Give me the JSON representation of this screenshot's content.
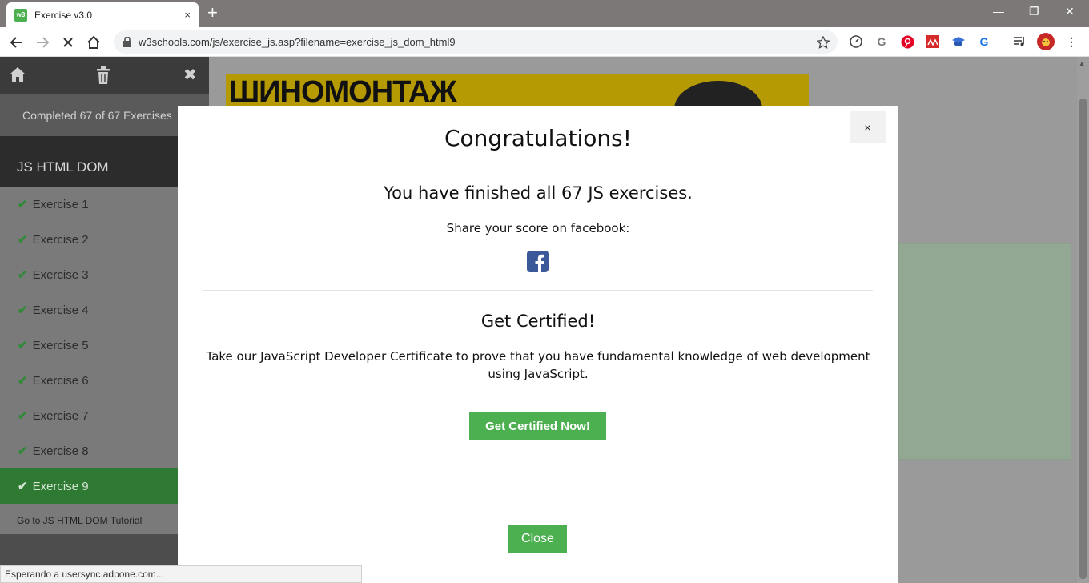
{
  "browser": {
    "tab_title": "Exercise v3.0",
    "favicon_text": "w3",
    "tab_close": "×",
    "new_tab": "+",
    "url": "w3schools.com/js/exercise_js.asp?filename=exercise_js_dom_html9",
    "window_controls": {
      "minimize": "—",
      "restore": "❐",
      "close": "✕"
    },
    "extensions": [
      "speed-icon",
      "google-icon",
      "pinterest-icon",
      "mosaic-icon",
      "cap-icon",
      "grammarly-icon",
      "media-icon",
      "avatar-icon"
    ],
    "extension_glyphs": {
      "google": "G",
      "grammarly": "G",
      "more": "⋮"
    },
    "status": "Esperando a usersync.adpone.com..."
  },
  "sidebar": {
    "completed": "Completed 67 of 67 Exercises",
    "section_title": "JS HTML DOM",
    "items": [
      {
        "label": "Exercise 1"
      },
      {
        "label": "Exercise 2"
      },
      {
        "label": "Exercise 3"
      },
      {
        "label": "Exercise 4"
      },
      {
        "label": "Exercise 5"
      },
      {
        "label": "Exercise 6"
      },
      {
        "label": "Exercise 7"
      },
      {
        "label": "Exercise 8"
      },
      {
        "label": "Exercise 9"
      }
    ],
    "active_index": 8,
    "tutorial_link": "Go to JS HTML DOM Tutorial",
    "close_glyph": "✖"
  },
  "ad": {
    "text": "ШИНОМОНТАЖ"
  },
  "modal": {
    "close": "×",
    "title": "Congratulations!",
    "finished": "You have finished all 67 JS exercises.",
    "share": "Share your score on facebook:",
    "cert_title": "Get Certified!",
    "cert_text": "Take our JavaScript Developer Certificate to prove that you have fundamental knowledge of web development using JavaScript.",
    "cert_button": "Get Certified Now!",
    "close_button": "Close"
  },
  "colors": {
    "accent_green": "#4caf50",
    "facebook_blue": "#3b5998",
    "sidebar_active": "#2f7a33"
  }
}
